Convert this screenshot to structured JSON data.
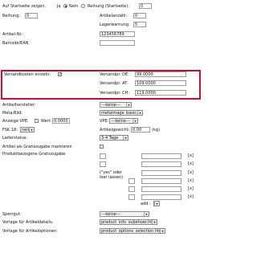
{
  "rows": {
    "startseite_label": "Auf Startseite zeigen:",
    "ja": "Ja",
    "nein": "Nein",
    "reihung_startseite_label": "Reihung (Startseite):",
    "reihung_startseite_value": "0",
    "reihung_label": "Reihung:",
    "reihung_value": "0",
    "artikelanzahl_label": "Artikelanzahl:",
    "artikelanzahl_value": "0",
    "lagerwarnung_label": "Lagerwarnung:",
    "lagerwarnung_value": "5",
    "artikelnr_label": "Artikel-Nr.:",
    "artikelnr_value": "123456789",
    "barcode_label": "Barcode/EAN",
    "barcode_value": "",
    "versandkosten_label": "Versandkosten einzeln:",
    "versandkosten_checked": true,
    "versand_de_label": "Versandpr. DE:",
    "versand_de_value": "99.0000",
    "versand_at_label": "Versandpr. AT:",
    "versand_at_value": "109.0000",
    "versand_ch_label": "Versandpr. CH:",
    "versand_ch_value": "119.0000",
    "hersteller_label": "Artikelhersteller:",
    "hersteller_value": "---keine---",
    "metabild_label": "Meta-Bild:",
    "metabild_value": "metaimage_basic.gif",
    "vpe_label": "Anzeige VPE:",
    "wert_label": "Wert:",
    "wert_value": "0.0000",
    "vpe2_label": "VPE:",
    "vpe2_value": "---keine---",
    "fsk_label": "FSK 18:",
    "fsk_value": "nein",
    "gewicht_label": "Artikelgewicht:",
    "gewicht_value": "0.00",
    "gewicht_unit": "(kg)",
    "lieferstatus_label": "Lieferstatus:",
    "lieferstatus_value": "3-4 Tage",
    "gratis_label": "Artikel als Gratiszugabe markieren",
    "produktbezogene_label": "Produktbezogene Gratiszugabe",
    "yes_hint": "(\"yes\" oder leer lassen)",
    "x_label": "[x]",
    "add_label": "add :",
    "sperrgut_label": "Sperrgut:",
    "sperrgut_value": "---keine---",
    "vorlage_details_label": "Vorlage für Artikeldetails:",
    "vorlage_details_value": "product_info_subehoer.html",
    "vorlage_optionen_label": "Vorlage für Artikeloptionen:",
    "vorlage_optionen_value": "product_options_selection.html"
  },
  "colors": {
    "highlight": "#c8102e"
  }
}
